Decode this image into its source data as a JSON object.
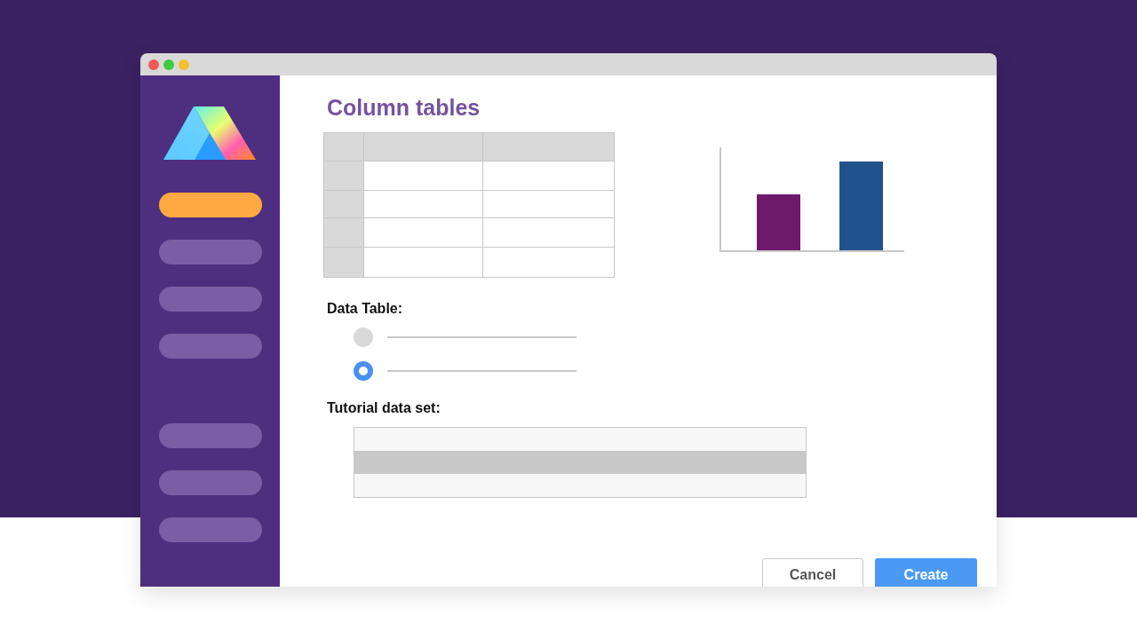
{
  "dialog": {
    "title": "Column tables"
  },
  "sidebar": {
    "sections": [
      {
        "items": [
          {
            "selected": true
          },
          {
            "selected": false
          },
          {
            "selected": false
          },
          {
            "selected": false
          }
        ]
      },
      {
        "items": [
          {
            "selected": false
          },
          {
            "selected": false
          },
          {
            "selected": false
          }
        ]
      }
    ]
  },
  "data_table": {
    "label": "Data Table:",
    "options": [
      {
        "selected": false
      },
      {
        "selected": true
      }
    ]
  },
  "tutorial": {
    "label": "Tutorial data set:",
    "rows": [
      {
        "selected": false
      },
      {
        "selected": true
      },
      {
        "selected": false
      }
    ]
  },
  "buttons": [
    {
      "label": "Cancel",
      "kind": "secondary"
    },
    {
      "label": "Create",
      "kind": "primary"
    }
  ]
}
